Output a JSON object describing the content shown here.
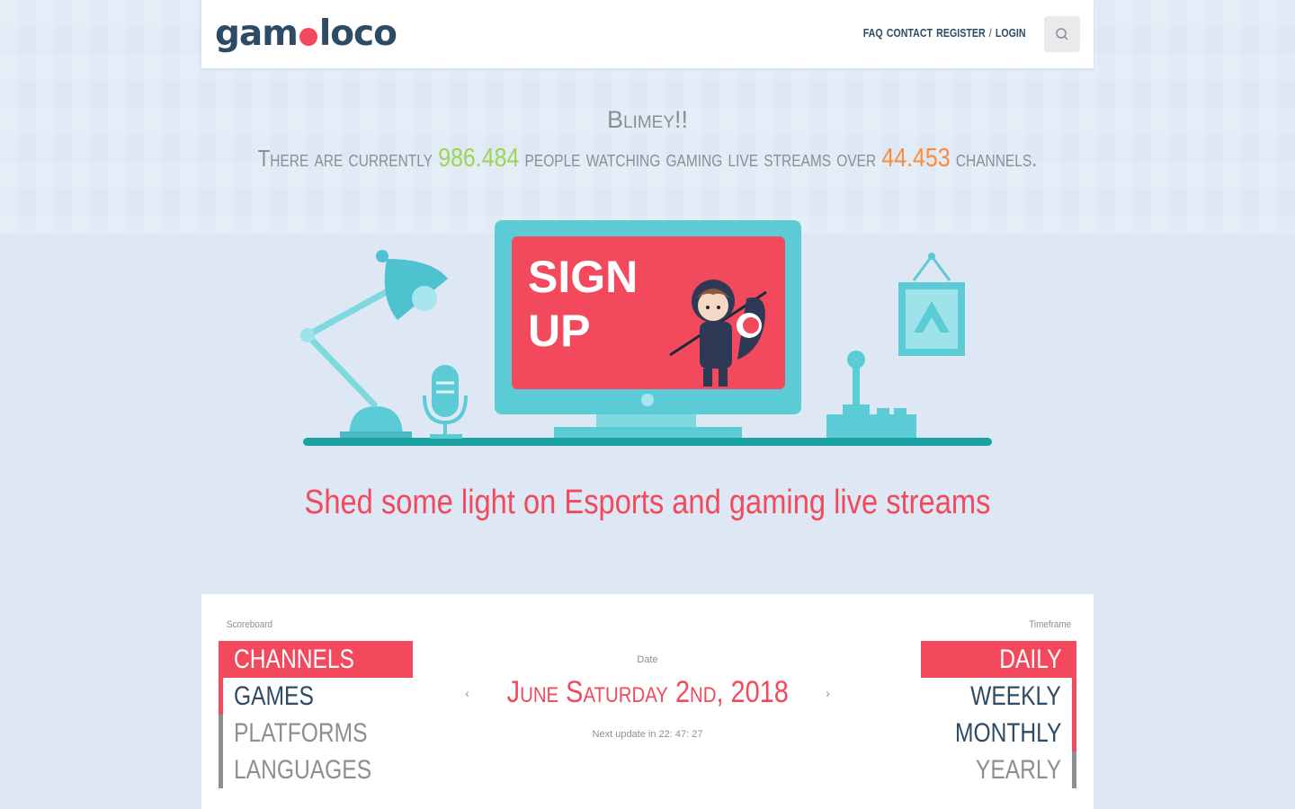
{
  "brand": {
    "logo_left": "gam",
    "logo_right": "loco"
  },
  "nav": {
    "faq": "FAQ",
    "contact": "CONTACT",
    "register": "REGISTER",
    "separator": "/",
    "login": "LOGIN",
    "search_icon": "search-icon"
  },
  "hero": {
    "title": "Blimey!!",
    "line_before": "There are currently ",
    "viewers": "986.484",
    "line_middle": " people watching gaming live streams over ",
    "channels": "44.453",
    "line_after": " channels.",
    "tagline": "Shed some light on Esports and gaming live streams"
  },
  "illustration": {
    "screen_text_1": "SIGN",
    "screen_text_2": "UP"
  },
  "scoreboard": {
    "label": "Scoreboard",
    "items": [
      {
        "label": "CHANNELS",
        "state": "active"
      },
      {
        "label": "GAMES",
        "state": "default"
      },
      {
        "label": "PLATFORMS",
        "state": "default"
      },
      {
        "label": "LANGUAGES",
        "state": "default"
      }
    ]
  },
  "date": {
    "label": "Date",
    "value": "June Saturday 2nd, 2018",
    "prev": "‹",
    "next": "›",
    "next_update": "Next update in 22: 47: 27"
  },
  "timeframe": {
    "label": "Timeframe",
    "items": [
      {
        "label": "DAILY",
        "state": "active"
      },
      {
        "label": "WEEKLY",
        "state": "default"
      },
      {
        "label": "MONTHLY",
        "state": "default"
      },
      {
        "label": "YEARLY",
        "state": "default"
      }
    ]
  },
  "colors": {
    "accent": "#f24a5c",
    "navy": "#2e4b66",
    "green": "#9fd453",
    "orange": "#ff8a3c",
    "teal": "#5bcbd6",
    "background": "#dde8f4"
  }
}
